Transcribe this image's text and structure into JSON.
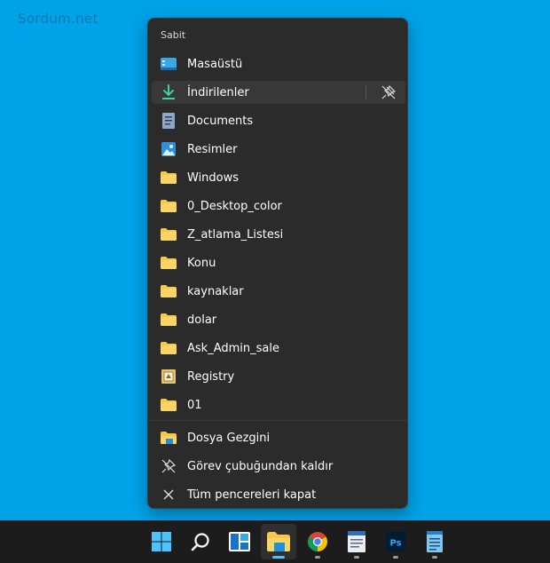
{
  "watermark": "Sordum.net",
  "jumplist": {
    "section_title": "Sabit",
    "pinned": [
      {
        "label": "Masaüstü",
        "icon": "desktop-icon"
      },
      {
        "label": "İndirilenler",
        "icon": "downloads-icon",
        "hovered": true
      },
      {
        "label": "Documents",
        "icon": "documents-icon"
      },
      {
        "label": "Resimler",
        "icon": "pictures-icon"
      },
      {
        "label": "Windows",
        "icon": "folder-icon"
      },
      {
        "label": "0_Desktop_color",
        "icon": "folder-icon"
      },
      {
        "label": "Z_atlama_Listesi",
        "icon": "folder-icon"
      },
      {
        "label": "Konu",
        "icon": "folder-icon"
      },
      {
        "label": "kaynaklar",
        "icon": "folder-icon"
      },
      {
        "label": "dolar",
        "icon": "folder-icon"
      },
      {
        "label": "Ask_Admin_sale",
        "icon": "folder-icon"
      },
      {
        "label": "Registry",
        "icon": "registry-icon"
      },
      {
        "label": "01",
        "icon": "folder-icon"
      }
    ],
    "actions": [
      {
        "label": "Dosya Gezgini",
        "icon": "file-explorer-icon"
      },
      {
        "label": "Görev çubuğundan kaldır",
        "icon": "unpin-icon"
      },
      {
        "label": "Tüm pencereleri kapat",
        "icon": "close-icon"
      }
    ]
  },
  "taskbar": {
    "items": [
      {
        "name": "start",
        "icon": "windows-start-icon"
      },
      {
        "name": "search",
        "icon": "search-icon"
      },
      {
        "name": "widgets",
        "icon": "widgets-icon"
      },
      {
        "name": "file-explorer",
        "icon": "file-explorer-icon",
        "active": true
      },
      {
        "name": "chrome",
        "icon": "chrome-icon"
      },
      {
        "name": "wordpad",
        "icon": "wordpad-icon"
      },
      {
        "name": "photoshop",
        "icon": "photoshop-icon",
        "text": "Ps"
      },
      {
        "name": "notepad",
        "icon": "notepad-icon"
      }
    ]
  },
  "colors": {
    "desktop": "#00a2e8",
    "menu_bg": "#2b2b2b",
    "taskbar_bg": "#1c1c1c",
    "accent": "#4cc2ff",
    "folder_yellow": "#f8c846"
  }
}
